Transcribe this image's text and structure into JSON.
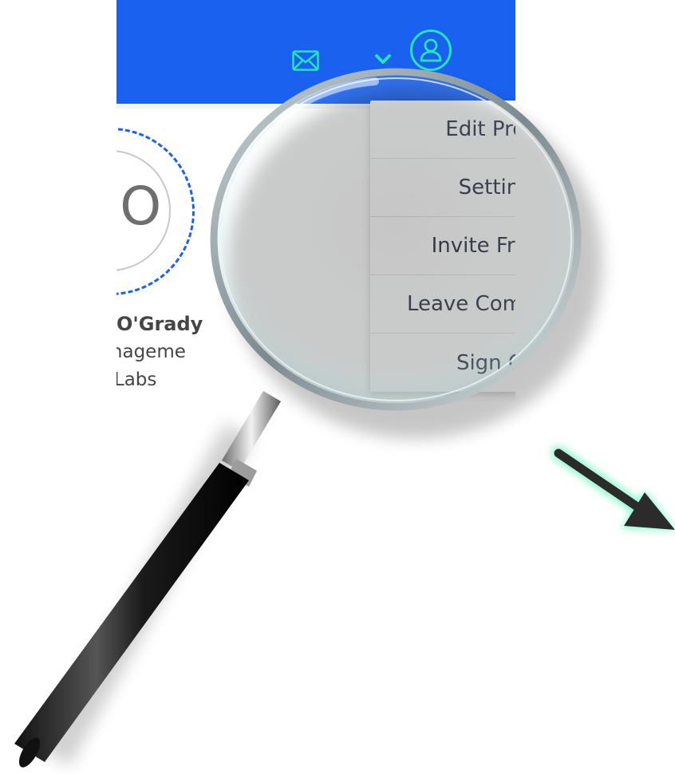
{
  "header": {
    "mail_icon": "envelope-icon",
    "chevron_icon": "chevron-down-icon",
    "user_icon": "user-circle-icon",
    "bar_color": "#1a61f0",
    "accent_color": "#22e6b4"
  },
  "profile": {
    "initials": "JO",
    "name": "O'Grady",
    "title": "ct Manageme",
    "company": "n Labs"
  },
  "menu": {
    "items": [
      {
        "label": "Edit Profile"
      },
      {
        "label": "Settings"
      },
      {
        "label": "Invite Friends"
      },
      {
        "label": "Leave Community"
      },
      {
        "label": "Sign Out"
      }
    ]
  },
  "decoration": {
    "magnifier": "magnifying-glass-icon",
    "arrow": "arrow-down-right-icon",
    "arrow_glow_color": "#7ef5c8"
  }
}
